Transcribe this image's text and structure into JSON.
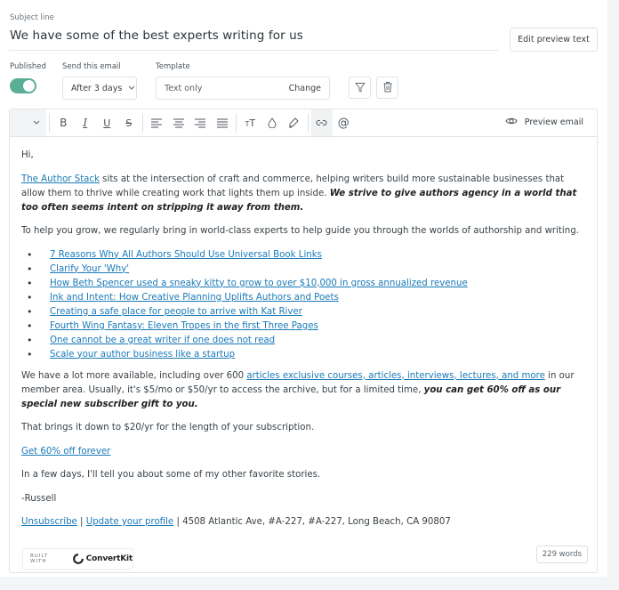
{
  "subject": {
    "label": "Subject line",
    "value": "We have some of the best experts writing for us",
    "edit_preview_label": "Edit preview text"
  },
  "controls": {
    "published_label": "Published",
    "published": true,
    "send_label": "Send this email",
    "send_value": "After 3 days",
    "template_label": "Template",
    "template_value": "Text only",
    "template_change": "Change"
  },
  "toolbar": {
    "buttons": [
      "bold",
      "italic",
      "underline",
      "strikethrough",
      "align-left",
      "align-center",
      "align-right",
      "justify",
      "font-size",
      "text-color",
      "highlight",
      "link",
      "mention"
    ],
    "active": "link",
    "preview_label": "Preview email"
  },
  "colors": {
    "toggle_on": "#5aae95",
    "link": "#1a7ab8"
  },
  "body": {
    "greeting": "Hi,",
    "p1_link": "The Author Stack",
    "p1_text": " sits at the intersection of craft and commerce, helping writers build more sustainable businesses that allow them to thrive while creating work that lights them up inside. ",
    "p1_bold": "We strive to give authors agency in a world that too often seems intent on stripping it away from them.",
    "p2": "To help you grow, we regularly bring in world-class experts to help guide you through the worlds of authorship and writing.",
    "links": [
      "7 Reasons Why All Authors Should Use Universal Book Links",
      "Clarify Your 'Why'",
      "How Beth Spencer used a sneaky kitty to grow to over $10,000 in gross annualized revenue",
      "Ink and Intent: How Creative Planning Uplifts Authors and Poets",
      "Creating a safe place for people to arrive with Kat River",
      "Fourth Wing Fantasy: Eleven Tropes in the first Three Pages",
      "One cannot be a great writer if one does not read",
      "Scale your author business like a startup"
    ],
    "p3_text1": "We have a lot more available, including over 600 ",
    "p3_link": "articles exclusive courses, articles, interviews, lectures, and more",
    "p3_text2": " in our member area. Usually, it's $5/mo or $50/yr to access the archive, but for a limited time, ",
    "p3_bold": "you can get 60% off as our special new subscriber gift to you.",
    "p4": "That brings it down to $20/yr for the length of your subscription.",
    "cta_link": "Get 60% off forever",
    "p5": "In a few days, I'll tell you about some of my other favorite stories.",
    "signature": "-Russell",
    "footer_unsubscribe": "Unsubscribe",
    "footer_sep": " | ",
    "footer_profile": "Update your profile",
    "footer_address": " | 4508 Atlantic Ave, #A-227, #A-227, Long Beach, CA 90807"
  },
  "footer": {
    "built_with": "BUILT WITH",
    "brand": "ConvertKit",
    "word_count": "229 words"
  }
}
